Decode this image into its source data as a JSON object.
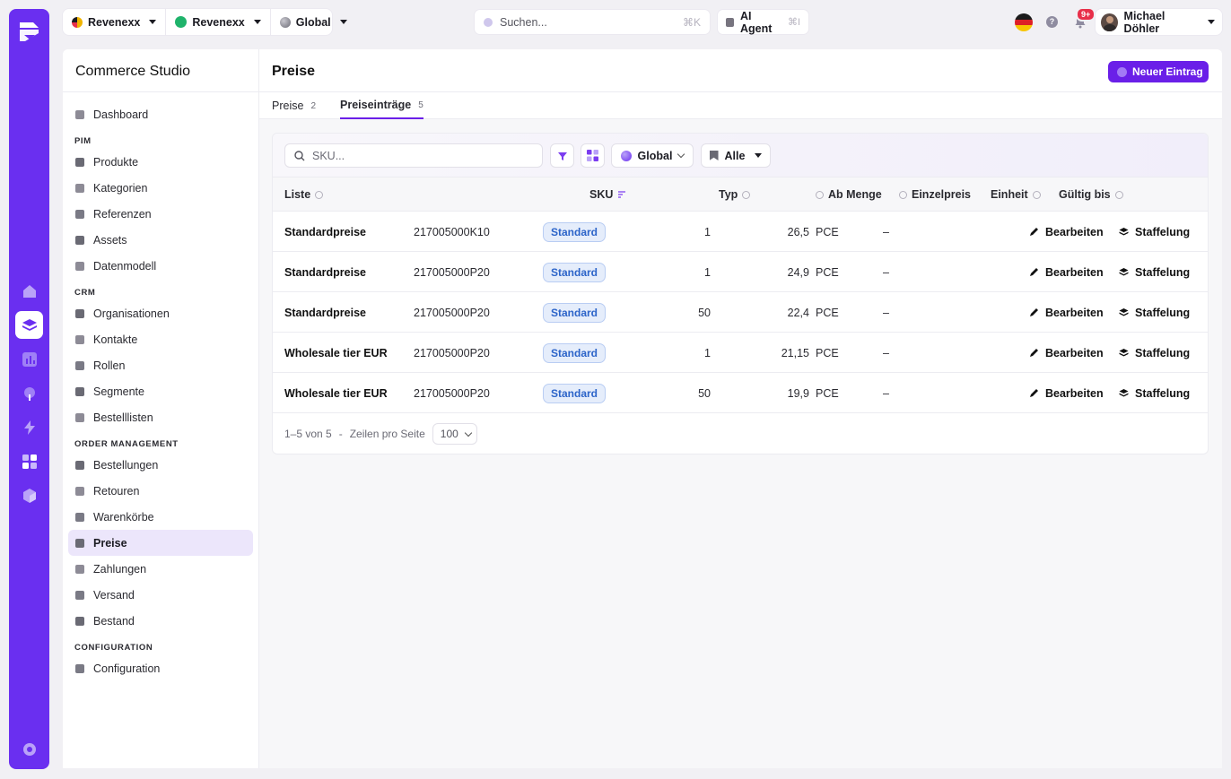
{
  "topbar": {
    "tenants": [
      {
        "label": "Revenexx",
        "icon": "revenexx-logo-icon",
        "color": "#f0b400"
      },
      {
        "label": "Revenexx",
        "icon": "green-dot-icon",
        "color": "#1fb36b"
      },
      {
        "label": "Global",
        "icon": "globe-icon",
        "color": "#6a6a74"
      }
    ],
    "search": {
      "placeholder": "Suchen...",
      "shortcut": "⌘K"
    },
    "ai_agent": {
      "label": "AI Agent",
      "shortcut": "⌘I"
    },
    "notifications_badge": "9+",
    "user_name": "Michael Döhler"
  },
  "sidebar": {
    "title": "Commerce Studio",
    "items": [
      {
        "type": "item",
        "label": "Dashboard"
      },
      {
        "type": "section",
        "label": "PIM"
      },
      {
        "type": "item",
        "label": "Produkte"
      },
      {
        "type": "item",
        "label": "Kategorien"
      },
      {
        "type": "item",
        "label": "Referenzen"
      },
      {
        "type": "item",
        "label": "Assets"
      },
      {
        "type": "item",
        "label": "Datenmodell"
      },
      {
        "type": "section",
        "label": "CRM"
      },
      {
        "type": "item",
        "label": "Organisationen"
      },
      {
        "type": "item",
        "label": "Kontakte"
      },
      {
        "type": "item",
        "label": "Rollen"
      },
      {
        "type": "item",
        "label": "Segmente"
      },
      {
        "type": "item",
        "label": "Bestelllisten"
      },
      {
        "type": "section",
        "label": "ORDER MANAGEMENT"
      },
      {
        "type": "item",
        "label": "Bestellungen"
      },
      {
        "type": "item",
        "label": "Retouren"
      },
      {
        "type": "item",
        "label": "Warenkörbe"
      },
      {
        "type": "item",
        "label": "Preise",
        "active": true
      },
      {
        "type": "item",
        "label": "Zahlungen"
      },
      {
        "type": "item",
        "label": "Versand"
      },
      {
        "type": "item",
        "label": "Bestand"
      },
      {
        "type": "section",
        "label": "CONFIGURATION"
      },
      {
        "type": "item",
        "label": "Configuration"
      }
    ]
  },
  "main": {
    "title": "Preise",
    "new_button": "Neuer Eintrag",
    "tabs": [
      {
        "label": "Preise",
        "count": "2"
      },
      {
        "label": "Preiseinträge",
        "count": "5",
        "active": true
      }
    ],
    "filters": {
      "sku_placeholder": "SKU...",
      "scope": "Global",
      "list": "Alle"
    },
    "columns": {
      "liste": "Liste",
      "sku": "SKU",
      "typ": "Typ",
      "ab_menge": "Ab Menge",
      "einzelpreis": "Einzelpreis",
      "einheit": "Einheit",
      "gueltig_bis": "Gültig bis"
    },
    "rows": [
      {
        "liste": "Standardpreise",
        "sku": "217005000K10",
        "typ": "Standard",
        "ab_menge": "1",
        "einzelpreis": "26,5",
        "einheit": "PCE",
        "gueltig_bis": "–"
      },
      {
        "liste": "Standardpreise",
        "sku": "217005000P20",
        "typ": "Standard",
        "ab_menge": "1",
        "einzelpreis": "24,9",
        "einheit": "PCE",
        "gueltig_bis": "–"
      },
      {
        "liste": "Standardpreise",
        "sku": "217005000P20",
        "typ": "Standard",
        "ab_menge": "50",
        "einzelpreis": "22,4",
        "einheit": "PCE",
        "gueltig_bis": "–"
      },
      {
        "liste": "Wholesale tier EUR",
        "sku": "217005000P20",
        "typ": "Standard",
        "ab_menge": "1",
        "einzelpreis": "21,15",
        "einheit": "PCE",
        "gueltig_bis": "–"
      },
      {
        "liste": "Wholesale tier EUR",
        "sku": "217005000P20",
        "typ": "Standard",
        "ab_menge": "50",
        "einzelpreis": "19,9",
        "einheit": "PCE",
        "gueltig_bis": "–"
      }
    ],
    "row_actions": {
      "edit": "Bearbeiten",
      "tiers": "Staffelung"
    },
    "pager": {
      "range": "1–5 von 5",
      "separator": "-",
      "rows_label": "Zeilen pro Seite",
      "page_size": "100"
    }
  },
  "colors": {
    "accent": "#6a1fe8",
    "rail": "#6a2ff0",
    "badge_bg": "#e5edfb",
    "badge_text": "#2c64c9"
  }
}
